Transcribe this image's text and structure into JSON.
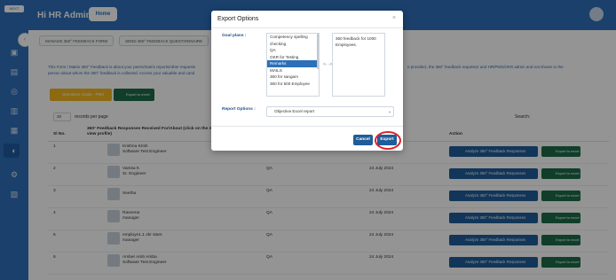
{
  "sidebar": {
    "logo": "NEXT"
  },
  "header": {
    "title": "Hi HR Admin",
    "home_label": "Home"
  },
  "tabs": [
    "MANAGE 360° FEEDBACK FORM",
    "SEND 360° FEEDBACK QUESTIONNAIRE",
    "ANALYZE 3"
  ],
  "notice": {
    "left_line1": "This Form / Matrix 360° Feedback is about your peers/matrix reports/other requests",
    "left_line2": "person about whom the 360° feedback is collected. Access your valuable and cand",
    "right_line1": "e provider), the 360° feedback requestor and HR/PMS/OKR admin and not shown to the"
  },
  "actions": {
    "upload_label": "Questions Guide - PMS",
    "export_label": "Export to excel"
  },
  "table": {
    "records_select": "20",
    "records_label": "records per page",
    "search_label": "Search:",
    "headers": {
      "sl": "Sl No.",
      "name": "360° Feedback Responses Received For/About (click on the name",
      "name2": "view profile)",
      "action": "Action"
    },
    "rows": [
      {
        "sl": "1",
        "name": "Krishna Krish",
        "role": "Software Test Engineer",
        "dept": "",
        "date": ""
      },
      {
        "sl": "2",
        "name": "Vamsa K",
        "role": "Sr. Engineer",
        "dept": "QA",
        "date": "24 July 2024"
      },
      {
        "sl": "3",
        "name": "Seetha",
        "role": "",
        "dept": "QA",
        "date": "24 July 2024"
      },
      {
        "sl": "4",
        "name": "Raveena",
        "role": "manager",
        "dept": "QA",
        "date": "24 July 2024"
      },
      {
        "sl": "5",
        "name": "employe1.1 okr stars",
        "role": "manager",
        "dept": "QA",
        "date": "24 July 2024"
      },
      {
        "sl": "6",
        "name": "Amber Amb Amba",
        "role": "Software Test Engineer",
        "dept": "QA",
        "date": "24 July 2024"
      }
    ],
    "analyze_label": "Analyze 360° Feedback Responses",
    "export_row_label": "Export to excel"
  },
  "modal": {
    "title": "Export Options",
    "close": "×",
    "goal_label": "Goal plans :",
    "goal_options": [
      "Competency spelling",
      "checking",
      "QA",
      "OKR for Testing",
      "Remarks",
      "MAILS",
      "360 for sangam",
      "360 for 500 Employee"
    ],
    "selected_index": 4,
    "move_arrows": "<- ->",
    "selected_goals": [
      "360 feedback for 1000",
      "Employees."
    ],
    "report_label": "Report Options :",
    "report_value": "Objective Excel report",
    "cancel_label": "Cancel",
    "export_label": "Export",
    "highlight_color": "#d9232a"
  }
}
